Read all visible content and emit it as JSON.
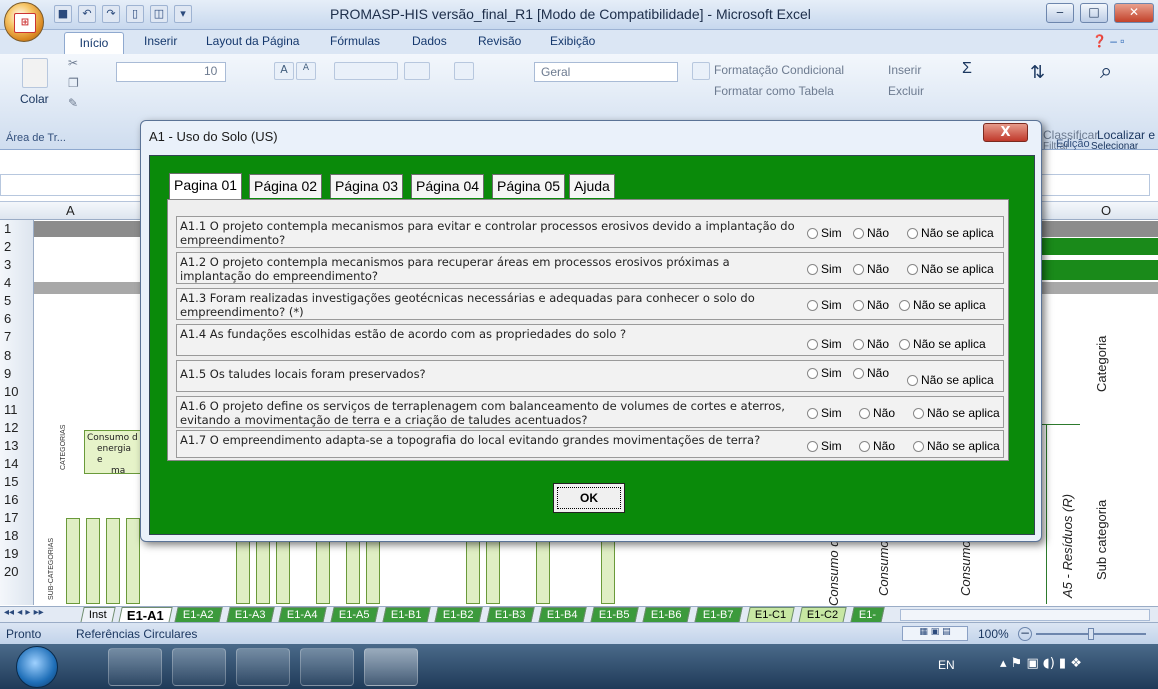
{
  "app": {
    "title": "PROMASP-HIS versão_final_R1  [Modo de Compatibilidade] - Microsoft Excel"
  },
  "ribbon": {
    "tabs": [
      "Início",
      "Inserir",
      "Layout da Página",
      "Fórmulas",
      "Dados",
      "Revisão",
      "Exibição"
    ],
    "paste_label": "Colar",
    "clipboard_group": "Área de Tr...",
    "font_size": "10",
    "number_format": "Geral",
    "styles": {
      "conditional": "Formatação Condicional",
      "table": "Formatar como Tabela"
    },
    "cells": {
      "insert": "Inserir",
      "delete": "Excluir"
    },
    "editing": {
      "sort": "Classificar",
      "filter": "Filtrar",
      "find": "Localizar e",
      "select": "Selecionar",
      "group": "Edição"
    }
  },
  "grid": {
    "col_a": "A",
    "col_o": "O",
    "rows": [
      "1",
      "2",
      "3",
      "4",
      "5",
      "6",
      "7",
      "8",
      "9",
      "10",
      "11",
      "12",
      "13",
      "14",
      "15",
      "16",
      "17",
      "18",
      "19",
      "20"
    ],
    "categoria": "Categoria",
    "sub_categoria": "Sub categoria",
    "categorias_label": "CATEGORIAS",
    "sub_categorias_label": "SUB-CATEGORIAS",
    "consumo_text": "Consumo d",
    "energia_text": "energia e",
    "ma_text": "ma",
    "residuos": "A5 - Resíduos (R)",
    "consumo_ce": "Consumo (CE",
    "consumo_cm": "Consumo (CM",
    "consumo_a": "Consumo d"
  },
  "sheet_tabs": [
    "Inst",
    "E1-A1",
    "E1-A2",
    "E1-A3",
    "E1-A4",
    "E1-A5",
    "E1-B1",
    "E1-B2",
    "E1-B3",
    "E1-B4",
    "E1-B5",
    "E1-B6",
    "E1-B7",
    "E1-C1",
    "E1-C2",
    "E1-"
  ],
  "status": {
    "ready": "Pronto",
    "circular": "Referências Circulares",
    "zoom": "100%"
  },
  "taskbar": {
    "lang": "EN"
  },
  "dialog": {
    "title": "A1 - Uso do Solo (US)",
    "close": "X",
    "tabs": [
      "Pagina 01",
      "Página 02",
      "Página 03",
      "Página 04",
      "Página 05",
      "Ajuda"
    ],
    "options": {
      "yes": "Sim",
      "no": "Não",
      "na": "Não se aplica"
    },
    "questions": [
      "A1.1 O projeto contempla mecanismos para evitar e controlar processos erosivos devido a implantação do empreendimento?",
      "A1.2 O projeto contempla mecanismos para recuperar áreas em processos erosivos próximas a implantação do empreendimento?",
      "A1.3 Foram realizadas investigações geotécnicas necessárias e adequadas  para conhecer o solo do empreendimento? (*)",
      "A1.4 As fundações escolhidas estão de acordo com as propriedades do solo ?",
      "A1.5 Os taludes locais foram preservados?",
      "A1.6 O projeto define os serviços de terraplenagem com balanceamento de volumes de cortes e aterros, evitando a movimentação de terra e a criação de taludes acentuados?",
      "A1.7 O empreendimento adapta-se a topografia do local evitando grandes movimentações de terra?"
    ],
    "ok": "OK"
  }
}
